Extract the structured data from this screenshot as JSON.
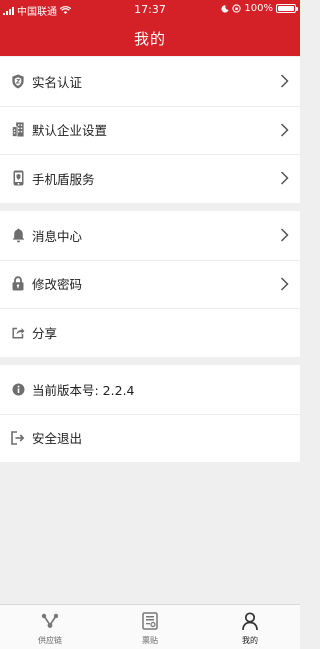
{
  "status_bar": {
    "carrier": "中国联通",
    "time": "17:37",
    "battery": "100%",
    "battery_level": 1.0
  },
  "header": {
    "title": "我的"
  },
  "groups": [
    {
      "items": [
        {
          "label": "实名认证",
          "icon": "shield-icon"
        },
        {
          "label": "默认企业设置",
          "icon": "building-icon"
        },
        {
          "label": "手机盾服务",
          "icon": "phone-shield-icon"
        }
      ]
    },
    {
      "items": [
        {
          "label": "消息中心",
          "icon": "bell-icon"
        },
        {
          "label": "修改密码",
          "icon": "lock-icon"
        },
        {
          "label": "分享",
          "icon": "share-icon"
        }
      ]
    },
    {
      "items": [
        {
          "label": "当前版本号: 2.2.4",
          "icon": "info-icon"
        },
        {
          "label": "安全退出",
          "icon": "logout-icon"
        }
      ]
    }
  ],
  "tabbar": {
    "tabs": [
      {
        "label": "供应链",
        "icon": "supply-chain-icon"
      },
      {
        "label": "票贴",
        "icon": "ticket-icon"
      },
      {
        "label": "我的",
        "icon": "person-icon",
        "active": true
      }
    ]
  },
  "colors": {
    "brand_red": "#d42027",
    "background": "#efefef",
    "icon_gray": "#6e6e6e"
  }
}
